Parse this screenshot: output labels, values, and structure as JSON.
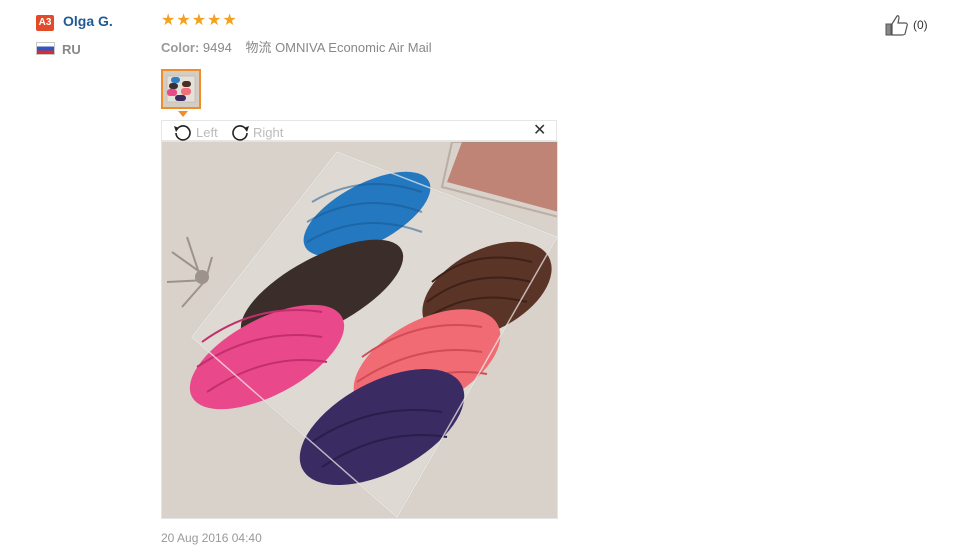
{
  "reviewer": {
    "badge": "A3",
    "name": "Olga G.",
    "country": "RU",
    "flag_colors": [
      "#ffffff",
      "#2f56c6",
      "#d62d2d"
    ]
  },
  "review": {
    "rating": 5,
    "star_color": "#f3a21e",
    "color_label": "Color:",
    "color_value": "9494",
    "shipping": "物流 OMNIVA Economic Air Mail",
    "date": "20 Aug 2016 04:40"
  },
  "viewer": {
    "rotate_left_label": "Left",
    "rotate_right_label": "Right",
    "close_symbol": "✕"
  },
  "like": {
    "count": "(0)"
  },
  "colors": {
    "name_link": "#1e5a93",
    "badge": "#e34a2a",
    "thumb_border": "#f08c2a"
  }
}
